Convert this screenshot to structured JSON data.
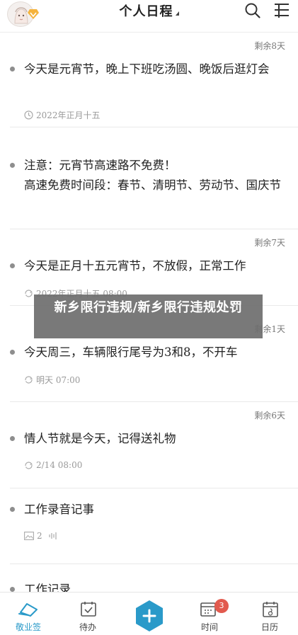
{
  "header": {
    "title": "个人日程",
    "icons": [
      "avatar",
      "search-icon",
      "menu-icon"
    ]
  },
  "items": [
    {
      "remaining": "剩余8天",
      "text": "今天是元宵节，晚上下班吃汤圆、晚饭后逛灯会",
      "meta_icon": "clock-icon",
      "meta": "2022年正月十五"
    },
    {
      "remaining": "",
      "text": "注意：元宵节高速路不免费！\n高速免费时间段：春节、清明节、劳动节、国庆节",
      "meta_icon": "",
      "meta": ""
    },
    {
      "remaining": "剩余7天",
      "text": "今天是正月十五元宵节，不放假，正常工作",
      "meta_icon": "repeat-icon",
      "meta": "2022年正月十五 08:00"
    },
    {
      "remaining": "剩余1天",
      "text": "今天周三，车辆限行尾号为3和8，不开车",
      "meta_icon": "repeat-icon",
      "meta": "明天 07:00"
    },
    {
      "remaining": "剩余6天",
      "text": "情人节就是今天，记得送礼物",
      "meta_icon": "repeat-icon",
      "meta": "2/14 08:00"
    },
    {
      "remaining": "",
      "text": "工作录音记事",
      "meta_icon": "image-icon",
      "meta": "2"
    },
    {
      "remaining": "",
      "text": "工作记录",
      "meta_icon": "",
      "meta": ""
    }
  ],
  "banner": {
    "text": "新乡限行违规/新乡限行违规处罚"
  },
  "tabbar": {
    "tabs": [
      {
        "label": "敬业签",
        "icon": "notebook-icon",
        "active": true
      },
      {
        "label": "待办",
        "icon": "todo-check-icon",
        "active": false
      },
      {
        "label": "",
        "icon": "add-icon",
        "active": false
      },
      {
        "label": "时间",
        "icon": "calendar-time-icon",
        "active": false,
        "badge": "3"
      },
      {
        "label": "日历",
        "icon": "calendar-icon",
        "active": false
      }
    ]
  },
  "colors": {
    "accent": "#2a9ac9",
    "badge": "#e25a4e",
    "bullet": "#8e8e8e",
    "meta_text": "#999999"
  }
}
